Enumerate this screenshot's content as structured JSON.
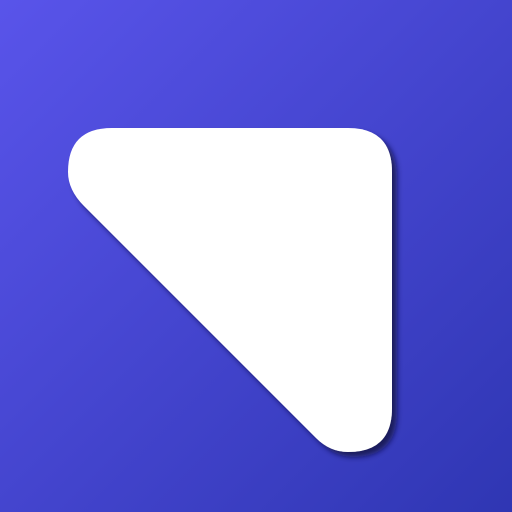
{
  "background": {
    "gradient_start": "#5954EA",
    "gradient_end": "#2F36B3"
  },
  "logo": {
    "icon_name": "rounded-triangle-logo-icon",
    "fill_color": "#FFFFFF",
    "shadow_color": "#11153A"
  }
}
